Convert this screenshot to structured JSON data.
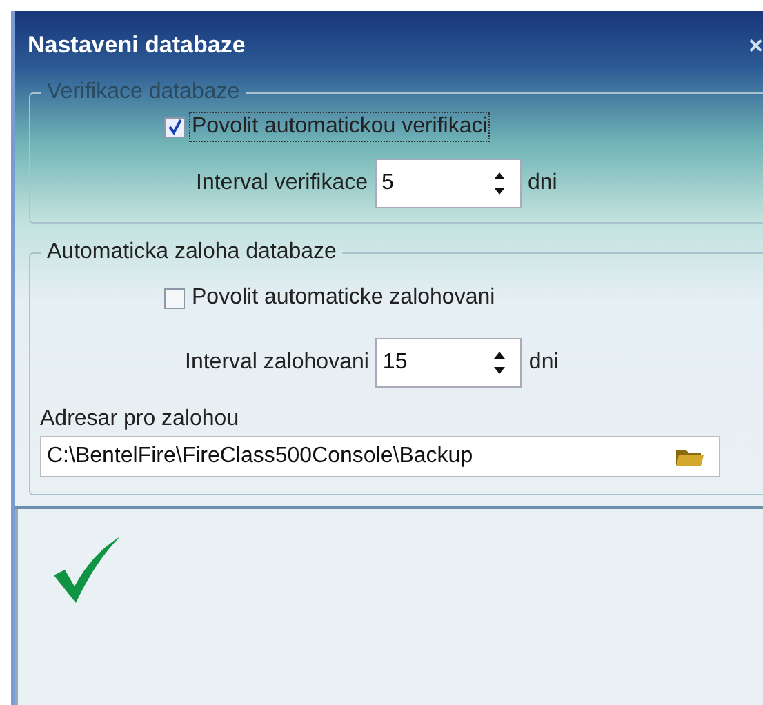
{
  "window": {
    "title": "Nastaveni databaze",
    "close": "×"
  },
  "groups": [
    {
      "title": "Verifikace databaze",
      "checkbox": {
        "label": "Povolit automatickou verifikaci",
        "checked": true,
        "focused": true
      },
      "interval": {
        "label": "Interval verifikace",
        "value": "5",
        "unit": "dni"
      }
    },
    {
      "title": "Automaticka zaloha databaze",
      "checkbox": {
        "label": "Povolit automaticke zalohovani",
        "checked": false,
        "focused": false
      },
      "interval": {
        "label": "Interval zalohovani",
        "value": "15",
        "unit": "dni"
      },
      "folder": {
        "label": "Adresar pro zalohou",
        "value": "C:\\BentelFire\\FireClass500Console\\Backup"
      }
    }
  ]
}
